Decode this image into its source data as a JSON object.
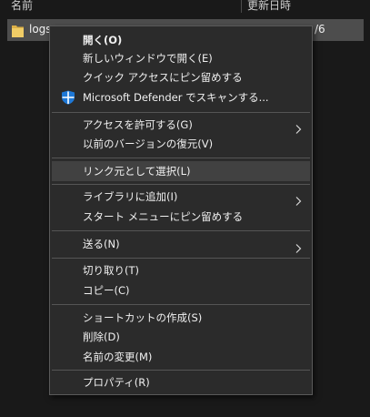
{
  "header": {
    "name_column": "名前",
    "modified_column": "更新日時"
  },
  "file": {
    "name": "logs",
    "date_fragment": "/6"
  },
  "menu": {
    "open": "開く(O)",
    "open_new_window": "新しいウィンドウで開く(E)",
    "pin_quick_access": "クイック アクセスにピン留めする",
    "defender_scan": "Microsoft Defender でスキャンする...",
    "give_access": "アクセスを許可する(G)",
    "restore_previous": "以前のバージョンの復元(V)",
    "select_as_link_source": "リンク元として選択(L)",
    "include_in_library": "ライブラリに追加(I)",
    "pin_to_start": "スタート メニューにピン留めする",
    "send_to": "送る(N)",
    "cut": "切り取り(T)",
    "copy": "コピー(C)",
    "create_shortcut": "ショートカットの作成(S)",
    "delete": "削除(D)",
    "rename": "名前の変更(M)",
    "properties": "プロパティ(R)"
  },
  "icons": {
    "folder": "folder-icon",
    "defender": "shield-icon",
    "submenu": "chevron-right-icon"
  },
  "colors": {
    "background": "#191919",
    "menu_background": "#2b2b2b",
    "highlight": "#414141",
    "selected_row": "#4d4d4d",
    "folder_yellow": "#e8c25a",
    "defender_blue": "#1e78d6"
  }
}
